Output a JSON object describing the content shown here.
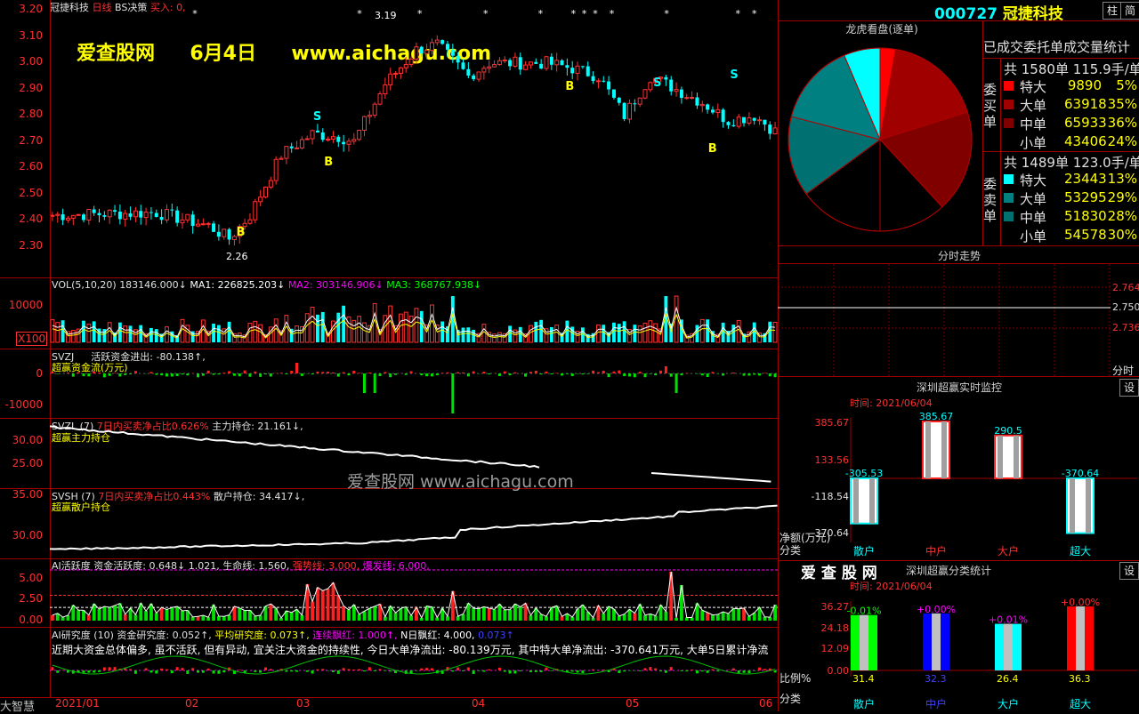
{
  "header": {
    "stock_name": "冠捷科技",
    "period": "日线",
    "indicator": "BS决策",
    "signal_label": "买入:",
    "signal_value": "0,"
  },
  "watermark": {
    "brand": "爱查股网",
    "date": "6月4日",
    "url": "www.aichagu.com",
    "center_text": "爱查股网 www.aichagu.com"
  },
  "price_axis": [
    "3.20",
    "3.10",
    "3.00",
    "2.90",
    "2.80",
    "2.70",
    "2.60",
    "2.50",
    "2.40",
    "2.30"
  ],
  "annotations": {
    "high": "3.19",
    "low": "2.26",
    "b": "B",
    "s": "S"
  },
  "vol": {
    "header": "VOL(5,10,20)",
    "value": "183146.000↓",
    "ma1": "MA1: 226825.203↓",
    "ma2": "MA2: 303146.906↓",
    "ma3": "MA3: 368767.938↓",
    "axis_top": "10000",
    "axis_unit": "X100"
  },
  "svzj": {
    "name": "SVZJ",
    "label": "活跃资金进出:",
    "value": "-80.138↑,",
    "sub": "超赢资金流(万元)",
    "axis": [
      "0",
      "-10000"
    ]
  },
  "svzl": {
    "name": "SVZL",
    "period": "(7)",
    "text1": "7日内买卖净占比0.626%",
    "text2": "主力持仓: 21.161↓,",
    "sub": "超赢主力持仓",
    "axis": [
      "30.00",
      "25.00"
    ]
  },
  "svsh": {
    "name": "SVSH",
    "period": "(7)",
    "text1": "7日内买卖净占比0.443%",
    "text2": "散户持仓: 34.417↓,",
    "sub": "超赢散户持仓",
    "axis": [
      "35.00",
      "30.00"
    ]
  },
  "ai_active": {
    "name": "AI活跃度",
    "t1": "资金活跃度: 0.648↓",
    "t2": "1.021,",
    "t3": "生命线: 1.560,",
    "t4": "强势线: 3.000,",
    "t5": "爆发线: 6.000,",
    "axis": [
      "5.00",
      "2.50",
      "0.00"
    ]
  },
  "ai_research": {
    "name": "AI研究度",
    "period": "(10)",
    "t1": "资金研究度: 0.052↑,",
    "t2": "平均研究度: 0.073↑,",
    "t3": "连续飘红: 1.000↑,",
    "t4": "N日飘红: 4.000,",
    "t5": "0.073↑",
    "comment": "近期大资金总体偏多, 虽不活跃, 但有异动, 宜关注大资金的持续性, 今日大单净流出: -80.139万元, 其中特大单净流出: -370.641万元, 大单5日累计净流"
  },
  "left_bottom": "大智慧",
  "date_axis": [
    "2021/01",
    "02",
    "03",
    "04",
    "05",
    "06"
  ],
  "right": {
    "code": "000727",
    "name": "冠捷科技",
    "btn1": "柱",
    "btn2": "简",
    "dragon_title": "龙虎看盘(逐单)",
    "stat_title": "已成交委托单成交量统计",
    "buy_side": "委买单",
    "sell_side": "委卖单",
    "buy_total": "共 1580单 115.9手/单",
    "sell_total": "共 1489单 123.0手/单",
    "buy_rows": [
      {
        "k": "特大",
        "v": "9890",
        "p": "5%",
        "c": "#ff0000"
      },
      {
        "k": "大单",
        "v": "63918",
        "p": "35%",
        "c": "#a00000"
      },
      {
        "k": "中单",
        "v": "65933",
        "p": "36%",
        "c": "#800000"
      },
      {
        "k": "小单",
        "v": "43406",
        "p": "24%",
        "c": "#000000"
      }
    ],
    "sell_rows": [
      {
        "k": "特大",
        "v": "23443",
        "p": "13%",
        "c": "#00ffff"
      },
      {
        "k": "大单",
        "v": "53295",
        "p": "29%",
        "c": "#008080"
      },
      {
        "k": "中单",
        "v": "51830",
        "p": "28%",
        "c": "#007070"
      },
      {
        "k": "小单",
        "v": "54578",
        "p": "30%",
        "c": "#000000"
      }
    ],
    "time_title": "分时走势",
    "time_axis": [
      "2.764",
      "2.750",
      "2.736"
    ],
    "time_unit": "分时",
    "monitor_title": "深圳超赢实时监控",
    "monitor_btn": "设",
    "monitor_time": "时间: 2021/06/04",
    "monitor_axis": [
      "385.67",
      "133.56",
      "-118.54",
      "-370.64"
    ],
    "monitor_unit": "净额(万元)",
    "category": "分类",
    "monitor_cats": [
      "散户",
      "中户",
      "大户",
      "超大"
    ],
    "monitor_vals": [
      "-305.53",
      "385.67",
      "290.5",
      "-370.64"
    ],
    "brand2": "爱 查 股 网",
    "class_title": "深圳超赢分类统计",
    "class_btn": "设",
    "class_time": "时间: 2021/06/04",
    "class_axis": [
      "36.27",
      "24.18",
      "12.09",
      "0.00"
    ],
    "class_unit": "比例%",
    "class_top": [
      "-0.01%",
      "+0.00%",
      "+0.01%",
      "+0.00%"
    ],
    "class_bottom": [
      "31.4",
      "32.3",
      "26.4",
      "36.3"
    ]
  },
  "chart_data": {
    "type": "pie",
    "title": "龙虎看盘(逐单)",
    "labels": [
      "委买特大",
      "委买大单",
      "委买中单",
      "委买小单",
      "委卖小单",
      "委卖中单",
      "委卖大单",
      "委卖特大"
    ],
    "values": [
      9890,
      63918,
      65933,
      43406,
      54578,
      51830,
      53295,
      23443
    ]
  }
}
